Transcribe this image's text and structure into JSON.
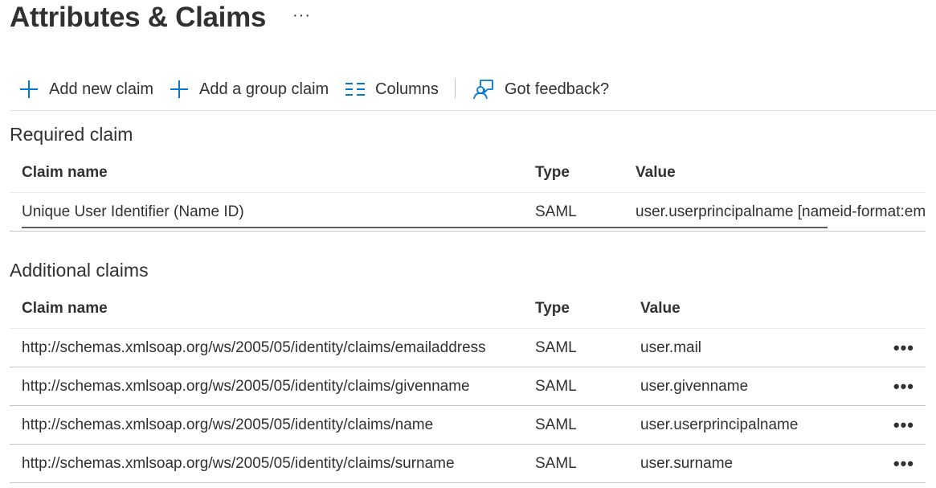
{
  "page": {
    "title": "Attributes & Claims",
    "more_label": "···"
  },
  "toolbar": {
    "add_claim": "Add new claim",
    "add_group_claim": "Add a group claim",
    "columns": "Columns",
    "feedback": "Got feedback?"
  },
  "required": {
    "title": "Required claim",
    "headers": {
      "name": "Claim name",
      "type": "Type",
      "value": "Value"
    },
    "rows": [
      {
        "name": "Unique User Identifier (Name ID)",
        "type": "SAML",
        "value": "user.userprincipalname [nameid-format:emailAddress]"
      }
    ]
  },
  "additional": {
    "title": "Additional claims",
    "headers": {
      "name": "Claim name",
      "type": "Type",
      "value": "Value"
    },
    "more_label": "•••",
    "rows": [
      {
        "name": "http://schemas.xmlsoap.org/ws/2005/05/identity/claims/emailaddress",
        "type": "SAML",
        "value": "user.mail"
      },
      {
        "name": "http://schemas.xmlsoap.org/ws/2005/05/identity/claims/givenname",
        "type": "SAML",
        "value": "user.givenname"
      },
      {
        "name": "http://schemas.xmlsoap.org/ws/2005/05/identity/claims/name",
        "type": "SAML",
        "value": "user.userprincipalname"
      },
      {
        "name": "http://schemas.xmlsoap.org/ws/2005/05/identity/claims/surname",
        "type": "SAML",
        "value": "user.surname"
      }
    ]
  },
  "colors": {
    "accent": "#0078d4",
    "text": "#323130",
    "divider": "#c8c6c4"
  },
  "icons": {
    "add": "plus-icon",
    "columns": "columns-icon",
    "feedback": "feedback-icon"
  }
}
